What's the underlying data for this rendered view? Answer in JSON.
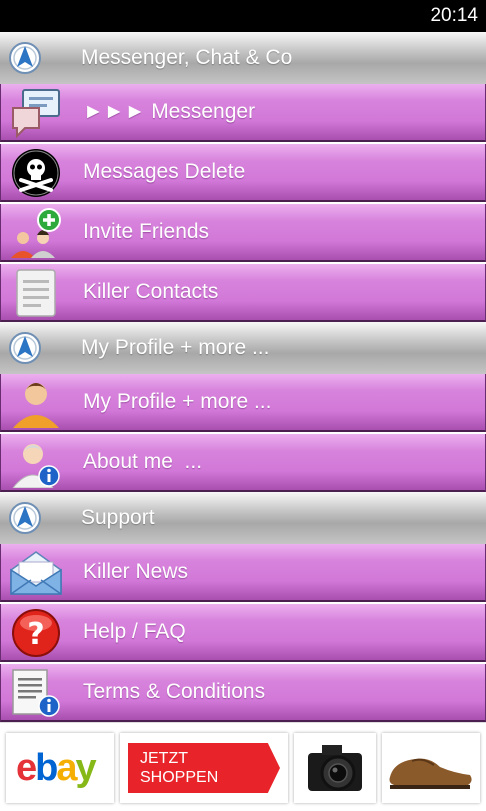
{
  "status_bar": {
    "time": "20:14"
  },
  "sections": [
    {
      "header": "Messenger, Chat & Co",
      "items": [
        {
          "label": "►►► Messenger",
          "icon": "chat-bubbles-icon"
        },
        {
          "label": "Messages Delete",
          "icon": "skull-crossbones-icon"
        },
        {
          "label": "Invite Friends",
          "icon": "add-friends-icon"
        },
        {
          "label": "Killer Contacts",
          "icon": "contacts-list-icon"
        }
      ]
    },
    {
      "header": "My Profile + more ...",
      "items": [
        {
          "label": "My Profile + more ...",
          "icon": "user-profile-icon"
        },
        {
          "label": "About me  ...",
          "icon": "user-info-icon"
        }
      ]
    },
    {
      "header": "Support",
      "items": [
        {
          "label": "Killer News",
          "icon": "envelope-icon"
        },
        {
          "label": "Help / FAQ",
          "icon": "help-question-icon"
        },
        {
          "label": "Terms & Conditions",
          "icon": "document-info-icon"
        }
      ]
    }
  ],
  "ad_banner": {
    "logo_letters": [
      "e",
      "b",
      "a",
      "y"
    ],
    "cta_line1": "JETZT",
    "cta_line2": "SHOPPEN",
    "products": [
      "camera-product-image",
      "shoe-product-image"
    ],
    "colors": {
      "ebay_e": "#e53238",
      "ebay_b": "#0064d2",
      "ebay_a": "#f5af02",
      "ebay_y": "#86b817",
      "cta_bg": "#e8242a"
    }
  },
  "colors": {
    "row_purple": "#d783dc",
    "header_gray": "#b8b8b8",
    "status_bar": "#000000"
  }
}
